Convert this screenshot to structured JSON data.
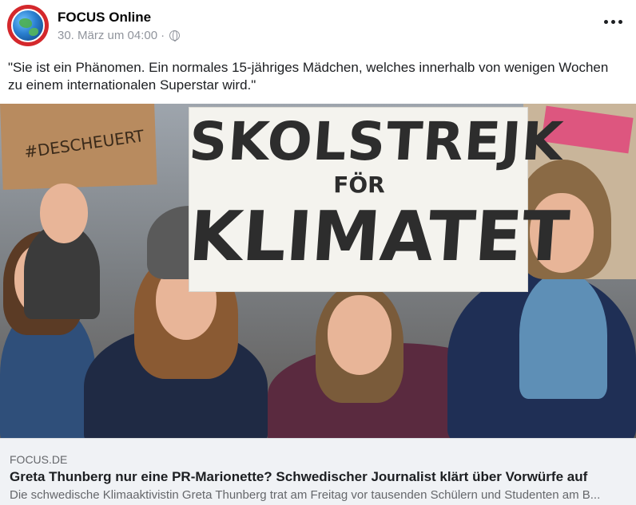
{
  "post": {
    "page_name": "FOCUS Online",
    "timestamp": "30. März um 04:00",
    "separator": "·",
    "privacy_icon": "globe-icon",
    "more_icon": "more-horizontal-icon",
    "text": "\"Sie ist ein Phänomen. Ein normales 15-jähriges Mädchen, welches innerhalb von wenigen Wochen zu einem internationalen Superstar wird.\""
  },
  "image": {
    "sign_main_line1": "SKOLSTREJK",
    "sign_main_line2": "FÖR",
    "sign_main_line3": "KLIMATET",
    "sign_left_text": "#DESCHEUERT"
  },
  "link": {
    "domain": "FOCUS.DE",
    "title": "Greta Thunberg nur eine PR-Marionette? Schwedischer Journalist klärt über Vorwürfe auf",
    "description": "Die schwedische Klimaaktivistin Greta Thunberg trat am Freitag vor tausenden Schülern und Studenten am B..."
  },
  "colors": {
    "avatar_ring": "#d4282c",
    "link_card_bg": "#f0f2f5",
    "meta_text": "#90949c"
  }
}
